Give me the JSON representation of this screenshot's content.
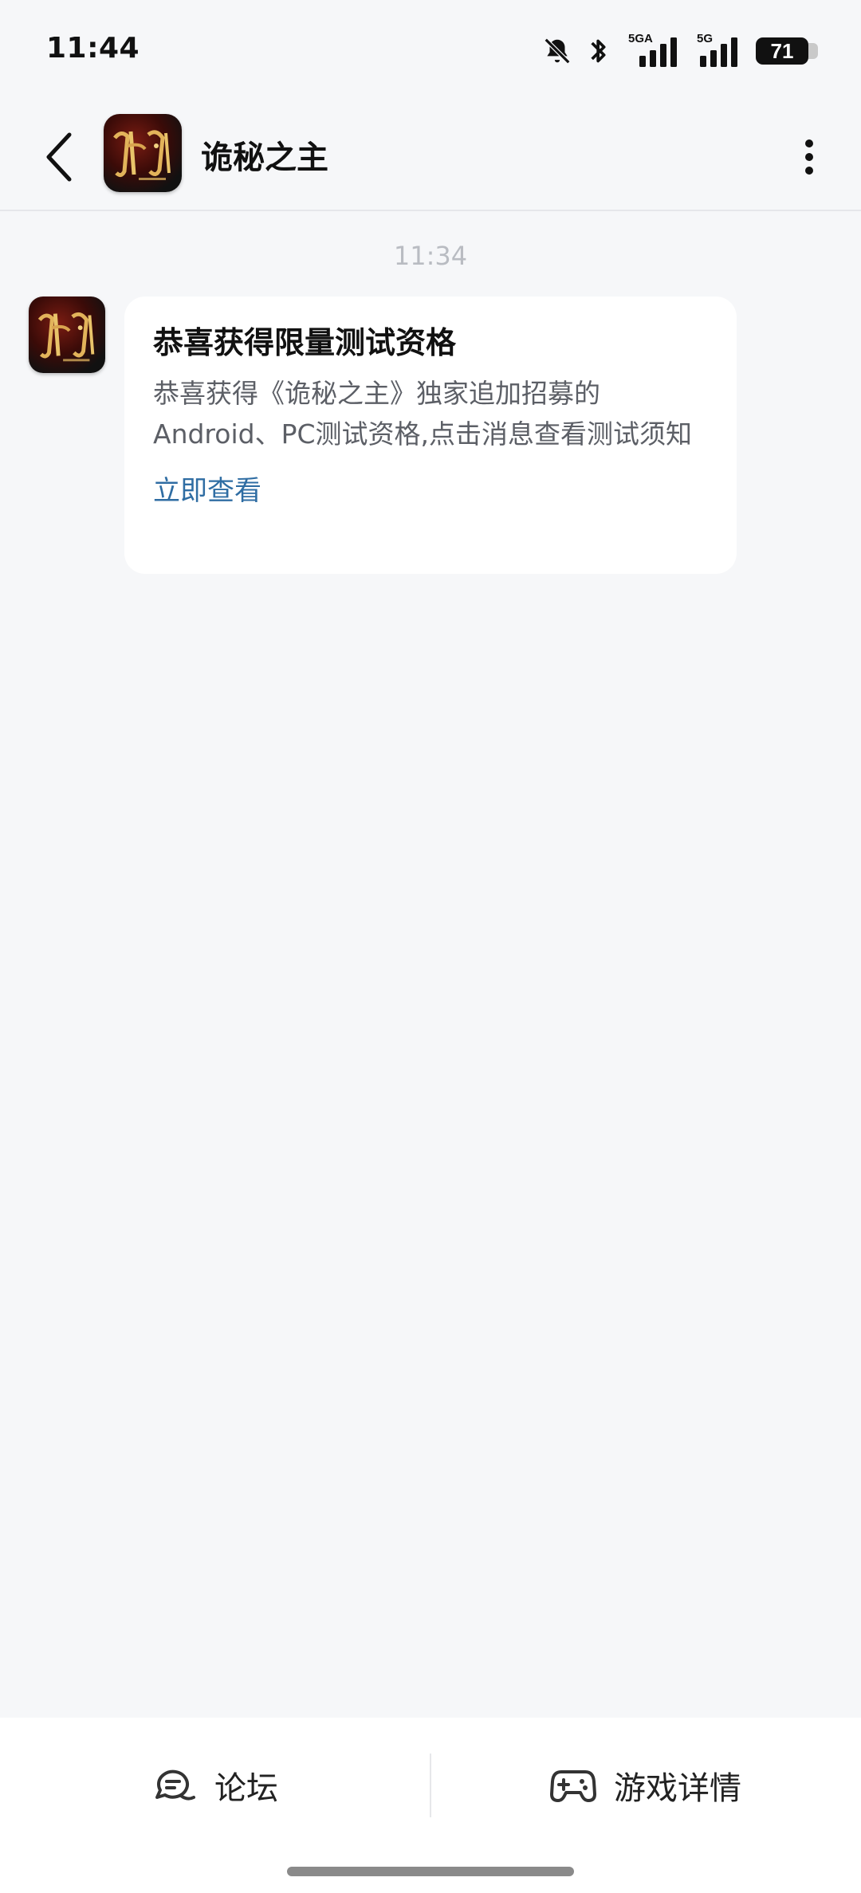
{
  "status_bar": {
    "time": "11:44",
    "network_1": "5GA",
    "network_2": "5G",
    "battery": "71"
  },
  "header": {
    "title": "诡秘之主",
    "avatar_icon": "game-logo-icon"
  },
  "chat": {
    "timestamp": "11:34",
    "message": {
      "title": "恭喜获得限量测试资格",
      "body": "恭喜获得《诡秘之主》独家追加招募的Android、PC测试资格,点击消息查看测试须知",
      "link": "立即查看"
    }
  },
  "bottom_bar": {
    "forum_label": "论坛",
    "game_details_label": "游戏详情"
  },
  "colors": {
    "background": "#f6f7f9",
    "link": "#2f6da3",
    "card": "#ffffff"
  }
}
